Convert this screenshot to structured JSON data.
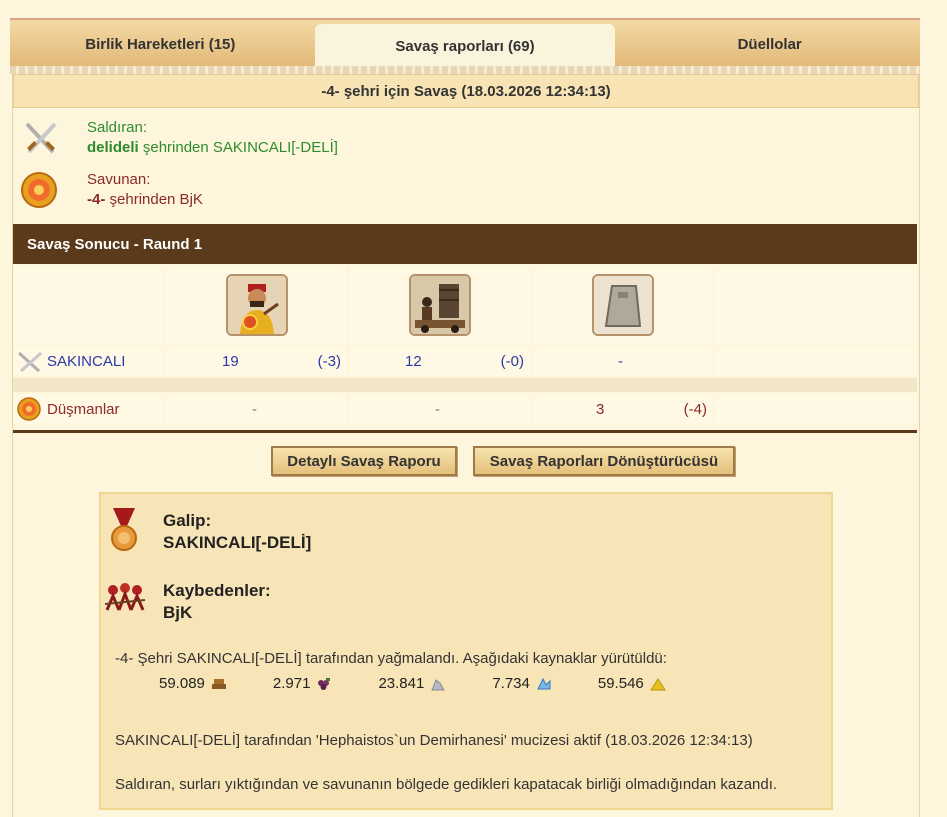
{
  "tabs": [
    {
      "label": "Birlik Hareketleri (15)",
      "active": false
    },
    {
      "label": "Savaş raporları (69)",
      "active": true
    },
    {
      "label": "Düellolar",
      "active": false
    }
  ],
  "battle": {
    "title": "-4- şehri için Savaş (18.03.2026 12:34:13)",
    "attacker": {
      "role": "Saldıran:",
      "city": "delideli",
      "rest": " şehrinden SAKINCALI[-DELİ]",
      "icon": "crossed-swords-icon"
    },
    "defender": {
      "role": "Savunan:",
      "city": "-4-",
      "rest": " şehrinden BjK",
      "icon": "shield-icon"
    }
  },
  "round": {
    "title": "Savaş Sonucu - Raund 1"
  },
  "units": [
    "slinger-unit-icon",
    "catapult-unit-icon",
    "wall-unit-icon"
  ],
  "rows": [
    {
      "name": "SAKINCALI",
      "cells": [
        {
          "count": "19",
          "loss": "(-3)"
        },
        {
          "count": "12",
          "loss": "(-0)"
        },
        {
          "count": "-",
          "loss": ""
        }
      ]
    },
    {
      "name": "Düşmanlar",
      "cells": [
        {
          "count": "-",
          "loss": ""
        },
        {
          "count": "-",
          "loss": ""
        },
        {
          "count": "3",
          "loss": "(-4)"
        }
      ]
    }
  ],
  "buttons": {
    "detail": "Detaylı Savaş Raporu",
    "converter": "Savaş Raporları Dönüştürücüsü"
  },
  "result": {
    "winner_label": "Galip:",
    "winner": "SAKINCALI[-DELİ]",
    "losers_label": "Kaybedenler:",
    "losers": "BjK",
    "plunder_text": "-4- Şehri SAKINCALI[-DELİ] tarafından yağmalandı. Aşağıdaki kaynaklar yürütüldü:",
    "resources": [
      {
        "value": "59.089",
        "icon": "wood-icon"
      },
      {
        "value": "2.971",
        "icon": "wine-icon"
      },
      {
        "value": "23.841",
        "icon": "marble-icon"
      },
      {
        "value": "7.734",
        "icon": "crystal-icon"
      },
      {
        "value": "59.546",
        "icon": "sulfur-icon"
      }
    ],
    "wonder_text": "SAKINCALI[-DELİ] tarafından 'Hephaistos`un Demirhanesi' mucizesi aktif (18.03.2026 12:34:13)",
    "reason_text": "Saldıran, surları yıktığından ve savunanın bölgede gedikleri kapatacak birliği olmadığından kazandı."
  },
  "colors": {
    "bar": "#5a3a1a",
    "attacker": "#2e8b2e",
    "defender": "#8b2a2a",
    "unit_count": "#2a3aa8"
  }
}
